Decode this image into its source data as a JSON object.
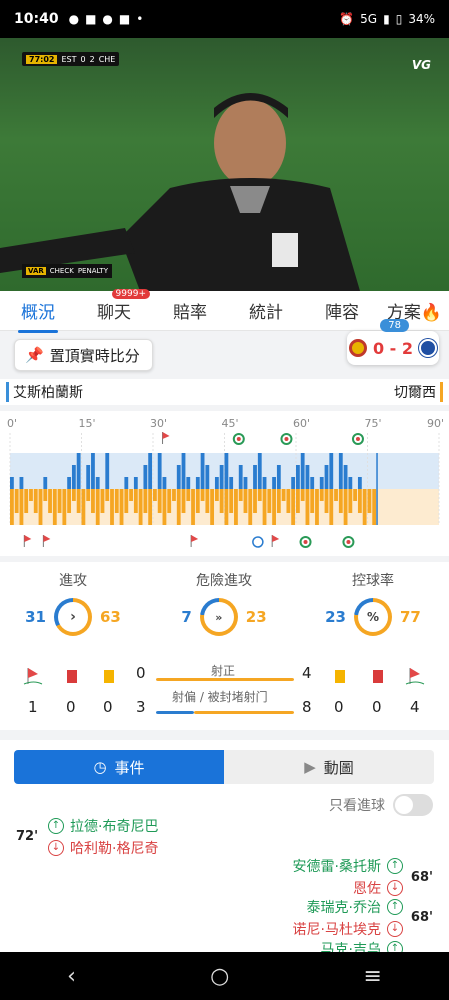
{
  "status": {
    "time": "10:40",
    "network": "5G",
    "battery": "34%"
  },
  "video": {
    "scorebug": {
      "minute": "77:02",
      "home_abbr": "EST",
      "home_score": "0",
      "away_score": "2",
      "away_abbr": "CHE"
    },
    "broadcaster": "VG",
    "var_tag": "VAR",
    "var_check": "CHECK",
    "var_type": "PENALTY"
  },
  "tabs": [
    {
      "label": "概況"
    },
    {
      "label": "聊天",
      "badge": "9999+"
    },
    {
      "label": "賠率"
    },
    {
      "label": "統計"
    },
    {
      "label": "陣容"
    },
    {
      "label": "方案"
    }
  ],
  "pin": {
    "label": "置頂實時比分"
  },
  "mini_score": {
    "minute": "78",
    "score": "0 - 2"
  },
  "teams": {
    "home": "艾斯柏蘭斯",
    "away": "切爾西"
  },
  "colors": {
    "home": "#2a7ccf",
    "away": "#f5a623",
    "accent": "#1a73d9"
  },
  "chart_data": {
    "type": "bar",
    "x_ticks": [
      "0'",
      "15'",
      "30'",
      "45'",
      "60'",
      "75'",
      "90'"
    ],
    "current_minute": 77,
    "home_attack": [
      1,
      0,
      1,
      0,
      0,
      0,
      0,
      1,
      0,
      0,
      0,
      0,
      1,
      2,
      3,
      0,
      2,
      3,
      1,
      0,
      3,
      0,
      0,
      0,
      1,
      0,
      1,
      0,
      2,
      3,
      0,
      3,
      1,
      0,
      0,
      2,
      3,
      1,
      0,
      1,
      3,
      2,
      0,
      1,
      2,
      3,
      1,
      0,
      2,
      1,
      0,
      2,
      3,
      1,
      0,
      1,
      2,
      0,
      0,
      1,
      2,
      3,
      2,
      1,
      0,
      1,
      2,
      3,
      0,
      3,
      2,
      1,
      0,
      1,
      0,
      0,
      0
    ],
    "away_attack": [
      3,
      2,
      3,
      2,
      1,
      2,
      3,
      1,
      2,
      3,
      2,
      3,
      2,
      1,
      2,
      3,
      1,
      2,
      3,
      2,
      1,
      3,
      2,
      3,
      2,
      1,
      2,
      3,
      2,
      3,
      1,
      2,
      3,
      2,
      1,
      3,
      2,
      1,
      3,
      2,
      1,
      2,
      3,
      1,
      2,
      3,
      2,
      3,
      1,
      2,
      3,
      2,
      1,
      3,
      2,
      3,
      2,
      1,
      2,
      3,
      2,
      1,
      3,
      2,
      3,
      1,
      2,
      3,
      1,
      2,
      3,
      2,
      1,
      2,
      3,
      2,
      3
    ]
  },
  "stats": {
    "attack": {
      "title": "進攻",
      "home": "31",
      "away": "63",
      "icon": "chevron-right-icon"
    },
    "danger": {
      "title": "危險進攻",
      "home": "7",
      "away": "23",
      "icon": "fast-forward-icon"
    },
    "possession": {
      "title": "控球率",
      "home": "23",
      "away": "77",
      "icon": "percent-icon"
    },
    "shots_on": {
      "label": "射正",
      "home": "0",
      "away": "4"
    },
    "shots_off": {
      "label": "射偏 / 被封堵射门",
      "home": "3",
      "away": "8"
    },
    "home_corners": "1",
    "home_red": "0",
    "home_yellow": "0",
    "away_yellow": "0",
    "away_red": "0",
    "away_corners": "4"
  },
  "events_tabs": {
    "events": "事件",
    "animation": "動圖"
  },
  "goal_only": "只看進球",
  "events": [
    {
      "minute": "72'",
      "in": "拉德·布奇尼巴",
      "out": "哈利勒·格尼奇",
      "side": "home"
    },
    {
      "minute": "68'",
      "in": "安德雷·桑托斯",
      "out": "恩佐",
      "side": "away"
    },
    {
      "minute": "68'",
      "in": "泰瑞克·乔治",
      "out": "诺尼·马杜埃克",
      "side": "away"
    },
    {
      "partial": "马克·吉乌"
    }
  ]
}
